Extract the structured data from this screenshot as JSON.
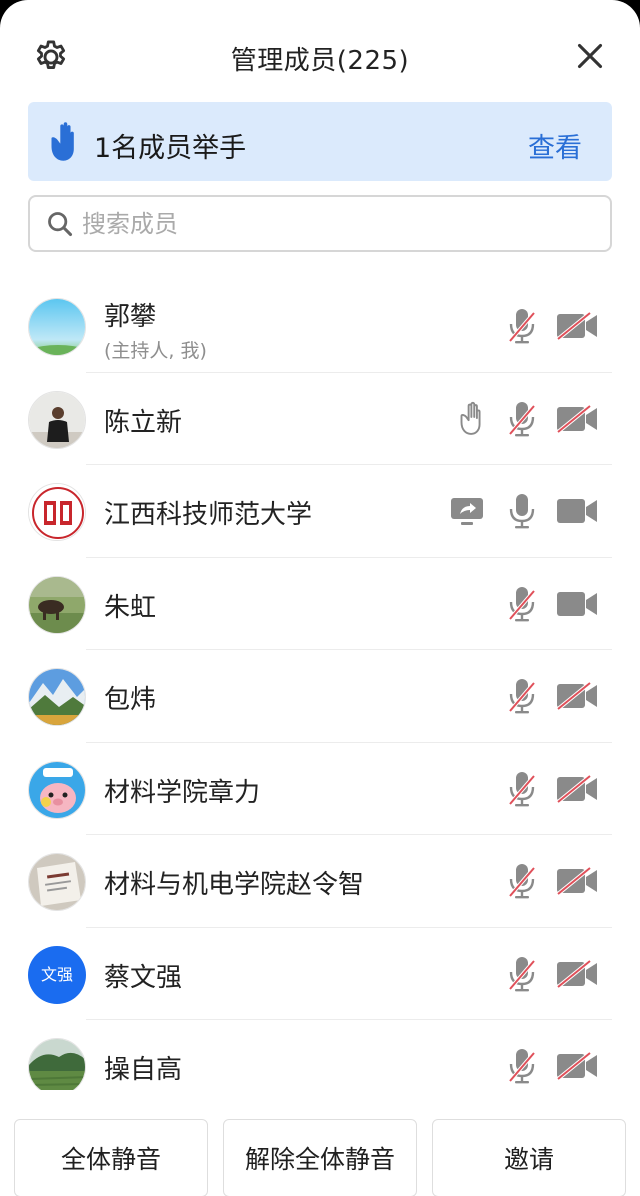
{
  "header": {
    "title": "管理成员(225)",
    "settings_icon": "gear-icon",
    "close_icon": "close-icon"
  },
  "raise_banner": {
    "text": "1名成员举手",
    "action_label": "查看",
    "icon": "raised-hand-icon",
    "accent": "#2a6fd6",
    "background": "#dbeafc"
  },
  "search": {
    "placeholder": "搜索成员",
    "value": ""
  },
  "members": [
    {
      "name": "郭攀",
      "role": "(主持人, 我)",
      "avatar": "sky",
      "hand": false,
      "share": false,
      "mic": "muted",
      "camera": "off"
    },
    {
      "name": "陈立新",
      "role": "",
      "avatar": "person",
      "hand": true,
      "share": false,
      "mic": "muted",
      "camera": "off"
    },
    {
      "name": "江西科技师范大学",
      "role": "",
      "avatar": "seal",
      "hand": false,
      "share": true,
      "mic": "on",
      "camera": "on"
    },
    {
      "name": "朱虹",
      "role": "",
      "avatar": "cow",
      "hand": false,
      "share": false,
      "mic": "muted",
      "camera": "on"
    },
    {
      "name": "包炜",
      "role": "",
      "avatar": "mountain",
      "hand": false,
      "share": false,
      "mic": "muted",
      "camera": "off"
    },
    {
      "name": "材料学院章力",
      "role": "",
      "avatar": "cartoon",
      "hand": false,
      "share": false,
      "mic": "muted",
      "camera": "off"
    },
    {
      "name": "材料与机电学院赵令智",
      "role": "",
      "avatar": "document",
      "hand": false,
      "share": false,
      "mic": "muted",
      "camera": "off"
    },
    {
      "name": "蔡文强",
      "role": "",
      "avatar": "text",
      "avatar_text": "文强",
      "hand": false,
      "share": false,
      "mic": "muted",
      "camera": "off"
    },
    {
      "name": "操自高",
      "role": "",
      "avatar": "field",
      "hand": false,
      "share": false,
      "mic": "muted",
      "camera": "off"
    }
  ],
  "footer": {
    "mute_all": "全体静音",
    "unmute_all": "解除全体静音",
    "invite": "邀请"
  },
  "colors": {
    "muted_slash": "#e0505a",
    "icon_gray": "#8a8a8a"
  }
}
